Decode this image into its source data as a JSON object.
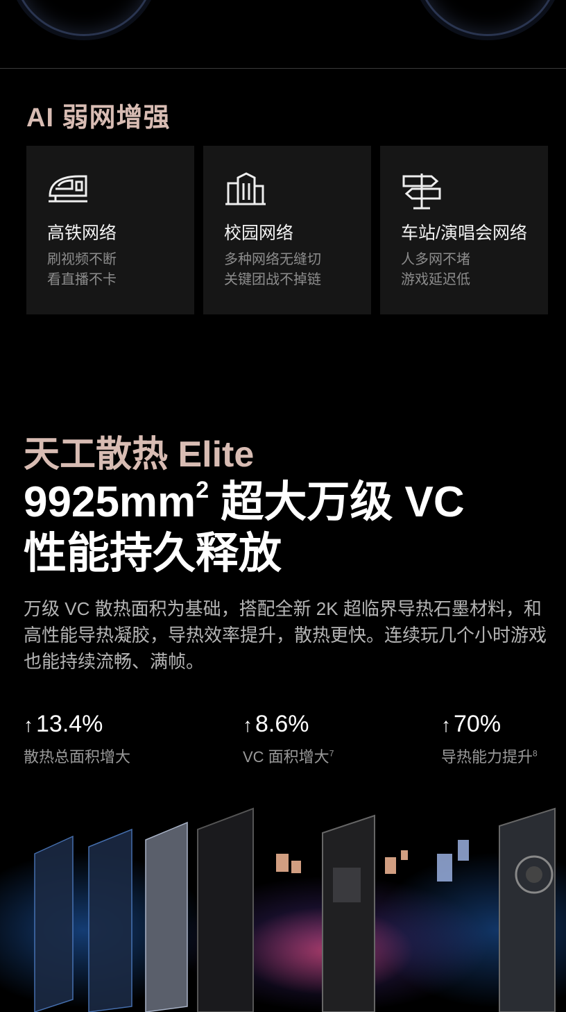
{
  "ai_section": {
    "title": "AI 弱网增强",
    "cards": [
      {
        "title": "高铁网络",
        "desc_line1": "刷视频不断",
        "desc_line2": "看直播不卡",
        "icon": "high-speed-train-icon"
      },
      {
        "title": "校园网络",
        "desc_line1": "多种网络无缝切",
        "desc_line2": "关键团战不掉链",
        "icon": "campus-building-icon"
      },
      {
        "title": "车站/演唱会网络",
        "desc_line1": "人多网不堵",
        "desc_line2": "游戏延迟低",
        "icon": "signpost-icon"
      }
    ]
  },
  "cooling_section": {
    "subtitle": "天工散热 Elite",
    "headline_line1_main": "9925mm",
    "headline_line1_sup": "2",
    "headline_line1_rest": " 超大万级 VC",
    "headline_line2": "性能持久释放",
    "paragraph": "万级 VC 散热面积为基础，搭配全新 2K 超临界导热石墨材料，和高性能导热凝胶，导热效率提升，散热更快。连续玩几个小时游戏也能持续流畅、满帧。",
    "stats": [
      {
        "value": "13.4%",
        "label": "散热总面积增大",
        "note": ""
      },
      {
        "value": "8.6%",
        "label": "VC 面积增大",
        "note": "7"
      },
      {
        "value": "70%",
        "label": "导热能力提升",
        "note": "8"
      }
    ],
    "arrow_symbol": "↑"
  },
  "colors": {
    "accent_rose": "#d8bcb3",
    "card_bg": "#161616",
    "page_bg": "#000000"
  }
}
